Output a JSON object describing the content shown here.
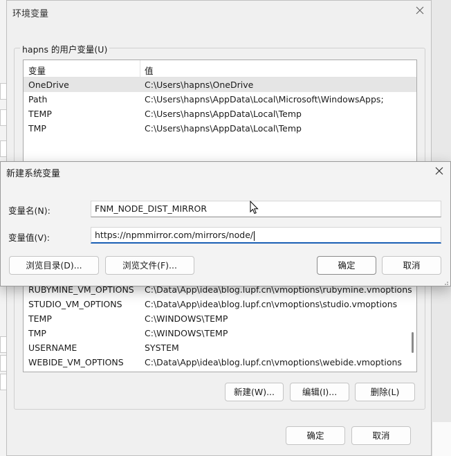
{
  "env_dialog": {
    "title": "环境变量",
    "user_group_label": "hapns 的用户变量(U)",
    "columns": {
      "name": "变量",
      "value": "值"
    },
    "user_vars": [
      {
        "name": "OneDrive",
        "value": "C:\\Users\\hapns\\OneDrive"
      },
      {
        "name": "Path",
        "value": "C:\\Users\\hapns\\AppData\\Local\\Microsoft\\WindowsApps;"
      },
      {
        "name": "TEMP",
        "value": "C:\\Users\\hapns\\AppData\\Local\\Temp"
      },
      {
        "name": "TMP",
        "value": "C:\\Users\\hapns\\AppData\\Local\\Temp"
      }
    ],
    "system_vars_visible": [
      {
        "name": "RUBYMINE_VM_OPTIONS",
        "value": "C:\\Data\\App\\idea\\blog.lupf.cn\\vmoptions\\rubymine.vmoptions"
      },
      {
        "name": "STUDIO_VM_OPTIONS",
        "value": "C:\\Data\\App\\idea\\blog.lupf.cn\\vmoptions\\studio.vmoptions"
      },
      {
        "name": "TEMP",
        "value": "C:\\WINDOWS\\TEMP"
      },
      {
        "name": "TMP",
        "value": "C:\\WINDOWS\\TEMP"
      },
      {
        "name": "USERNAME",
        "value": "SYSTEM"
      },
      {
        "name": "WEBIDE_VM_OPTIONS",
        "value": "C:\\Data\\App\\idea\\blog.lupf.cn\\vmoptions\\webide.vmoptions"
      }
    ],
    "system_buttons": {
      "new": "新建(W)...",
      "edit": "编辑(I)...",
      "delete": "删除(L)"
    },
    "footer_buttons": {
      "ok": "确定",
      "cancel": "取消"
    }
  },
  "new_var_dialog": {
    "title": "新建系统变量",
    "name_label": "变量名(N):",
    "name_value": "FNM_NODE_DIST_MIRROR",
    "value_label": "变量值(V):",
    "value_value": "https://npmmirror.com/mirrors/node/",
    "buttons": {
      "browse_dir": "浏览目录(D)...",
      "browse_file": "浏览文件(F)...",
      "ok": "确定",
      "cancel": "取消"
    }
  },
  "icons": [
    "close-icon",
    "mouse-cursor-icon",
    "resize-grip-icon"
  ]
}
